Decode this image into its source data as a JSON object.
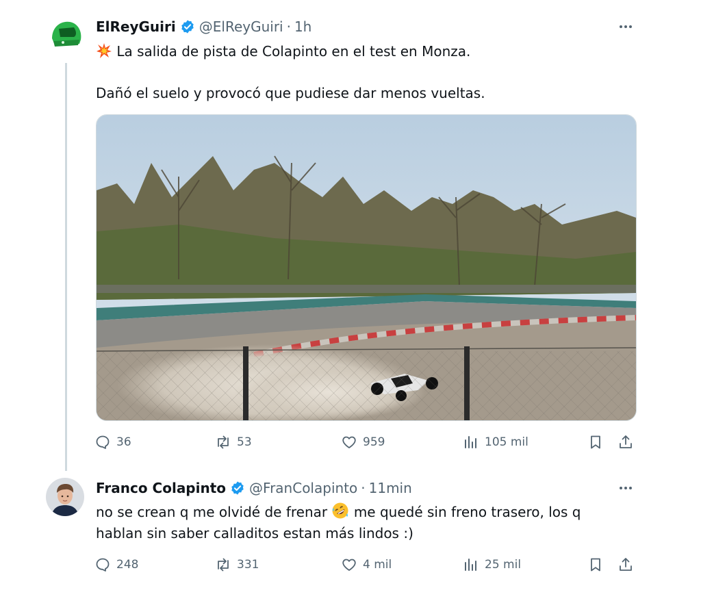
{
  "tweet1": {
    "author_name": "ElReyGuiri",
    "handle": "@ElReyGuiri",
    "separator": "·",
    "time": "1h",
    "emoji": "collision-emoji",
    "line1": "La salida de pista de Colapinto en el test en Monza.",
    "line2": "Dañó el suelo y provocó que pudiese dar menos vueltas.",
    "replies": "36",
    "reposts": "53",
    "likes": "959",
    "views": "105 mil"
  },
  "tweet2": {
    "author_name": "Franco Colapinto",
    "handle": "@FranColapinto",
    "separator": "·",
    "time": "11min",
    "line1_a": "no se crean q me olvidé de frenar",
    "emoji": "rolling-on-floor-laughing-emoji",
    "line1_b": "me quedé sin freno trasero, los q",
    "line2": "hablan sin saber calladitos estan más lindos :)",
    "replies": "248",
    "reposts": "331",
    "likes": "4 mil",
    "views": "25 mil"
  },
  "colors": {
    "text": "#0f1419",
    "muted": "#536471",
    "verified": "#1d9bf0",
    "helmet": "#2bb34a"
  }
}
